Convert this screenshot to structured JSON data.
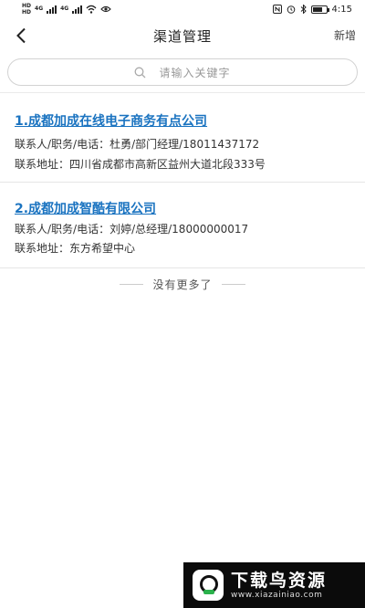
{
  "status_bar": {
    "time": "4:15",
    "network_top": "4G",
    "network_bottom": "HD",
    "network_mid": "4G",
    "battery_level": 0.75,
    "icons": [
      "signal-icon",
      "wifi-icon",
      "eye-icon",
      "nfc-icon",
      "alarm-icon",
      "bluetooth-icon",
      "battery-icon"
    ]
  },
  "nav": {
    "title": "渠道管理",
    "action": "新增",
    "back_icon": "chevron-left-icon"
  },
  "search": {
    "placeholder": "请输入关键字",
    "icon": "search-icon"
  },
  "channels": [
    {
      "name": "1.成都加成在线电子商务有点公司",
      "contact": "联系人/职务/电话：杜勇/部门经理/18011437172",
      "address": "联系地址：四川省成都市高新区益州大道北段333号"
    },
    {
      "name": "2.成都加成智酷有限公司",
      "contact": "联系人/职务/电话：刘婷/总经理/18000000017",
      "address": "联系地址：东方希望中心"
    }
  ],
  "list_end": "没有更多了",
  "watermark": {
    "main": "下载鸟资源",
    "sub": "www.xiazainiao.com"
  },
  "colors": {
    "link": "#1a73c0",
    "text": "#333333",
    "muted": "#999999",
    "divider": "#e6e6e6"
  }
}
